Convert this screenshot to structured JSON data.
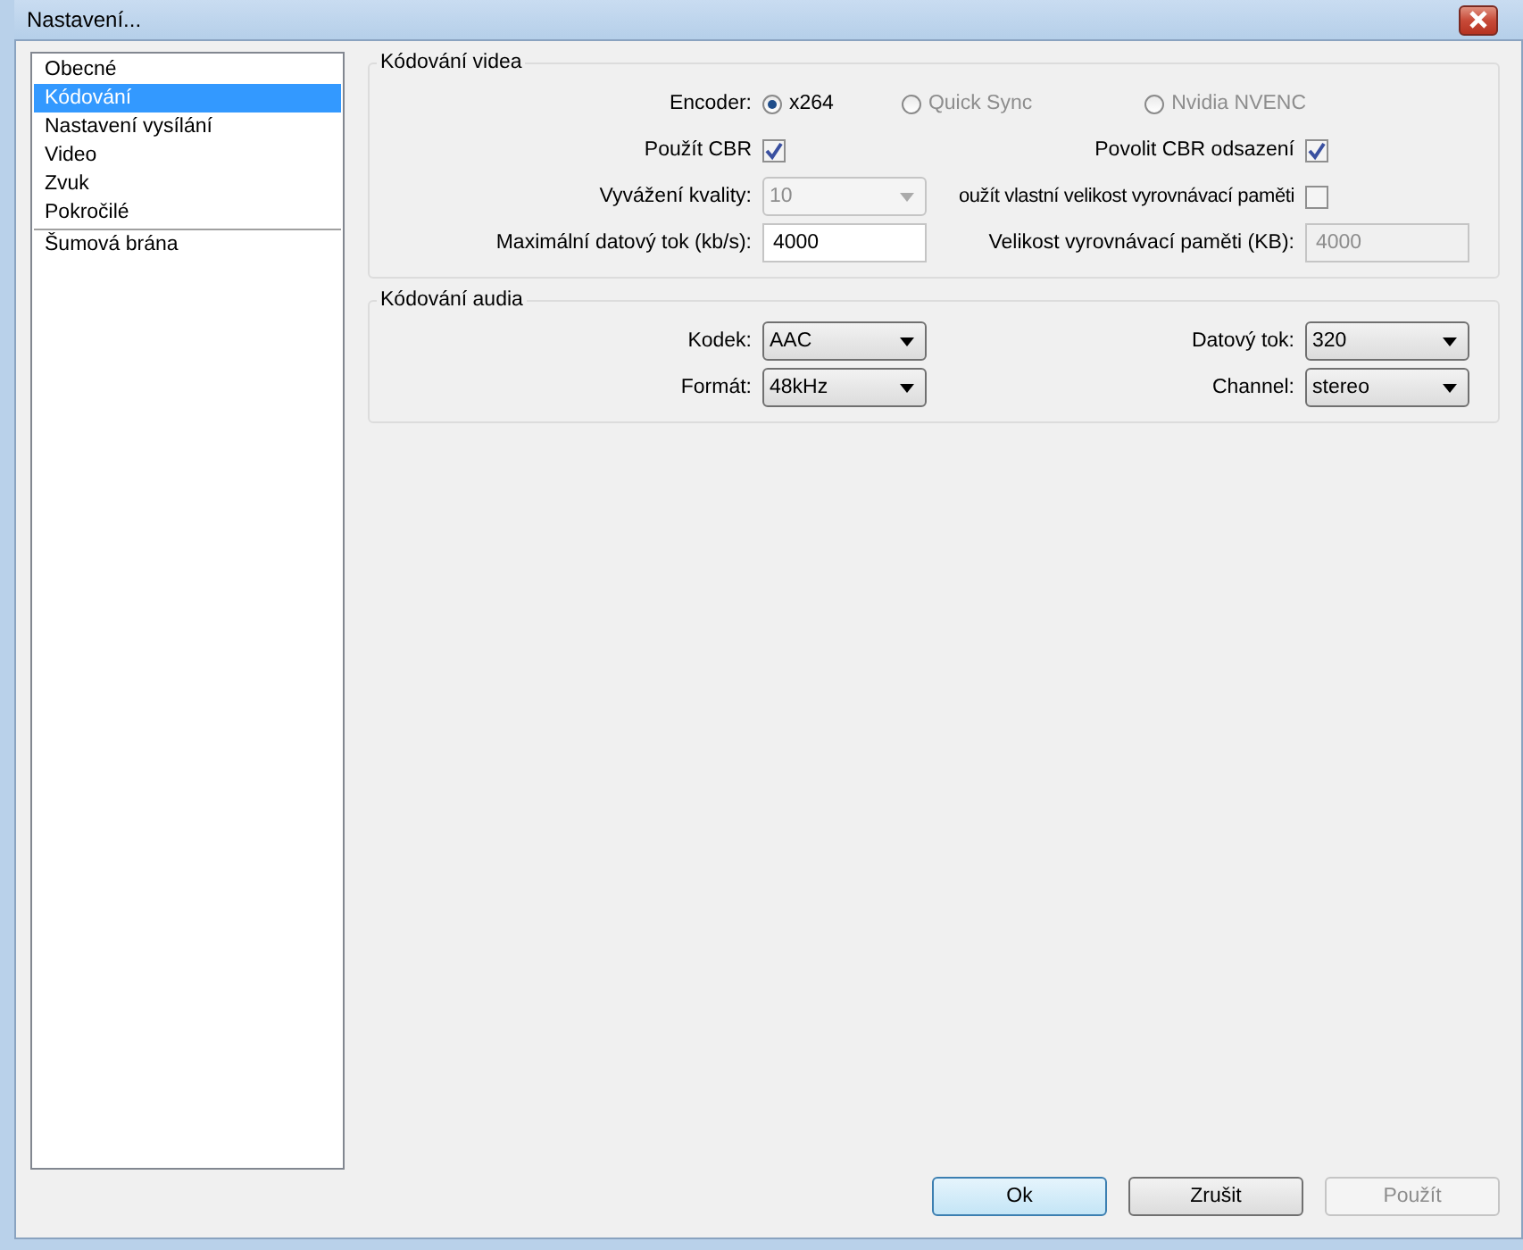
{
  "window": {
    "title": "Nastavení..."
  },
  "sidebar": {
    "items": [
      {
        "label": "Obecné",
        "selected": false
      },
      {
        "label": "Kódování",
        "selected": true
      },
      {
        "label": "Nastavení vysílání",
        "selected": false
      },
      {
        "label": "Video",
        "selected": false
      },
      {
        "label": "Zvuk",
        "selected": false
      },
      {
        "label": "Pokročilé",
        "selected": false
      }
    ],
    "extra_items": [
      {
        "label": "Šumová brána",
        "selected": false
      }
    ]
  },
  "video_group": {
    "title": "Kódování videa",
    "encoder": {
      "label": "Encoder:",
      "options": [
        {
          "label": "x264",
          "selected": true,
          "disabled": false
        },
        {
          "label": "Quick Sync",
          "selected": false,
          "disabled": true
        },
        {
          "label": "Nvidia NVENC",
          "selected": false,
          "disabled": true
        }
      ]
    },
    "use_cbr": {
      "label": "Použít CBR",
      "checked": true
    },
    "cbr_padding": {
      "label": "Povolit CBR odsazení",
      "checked": true
    },
    "quality": {
      "label": "Vyvážení kvality:",
      "value": "10",
      "disabled": true
    },
    "custom_buffer": {
      "label": "oužít vlastní velikost vyrovnávací paměti",
      "checked": false
    },
    "max_bitrate": {
      "label": "Maximální datový tok (kb/s):",
      "value": "4000",
      "disabled": false
    },
    "buffer_size": {
      "label": "Velikost vyrovnávací paměti (KB):",
      "value": "4000",
      "disabled": true
    }
  },
  "audio_group": {
    "title": "Kódování audia",
    "codec": {
      "label": "Kodek:",
      "value": "AAC"
    },
    "bitrate": {
      "label": "Datový tok:",
      "value": "320"
    },
    "format": {
      "label": "Formát:",
      "value": "48kHz"
    },
    "channel": {
      "label": "Channel:",
      "value": "stereo"
    }
  },
  "buttons": [
    {
      "label": "Ok",
      "kind": "default",
      "disabled": false
    },
    {
      "label": "Zrušit",
      "kind": "normal",
      "disabled": false
    },
    {
      "label": "Použít",
      "kind": "normal",
      "disabled": true
    }
  ]
}
